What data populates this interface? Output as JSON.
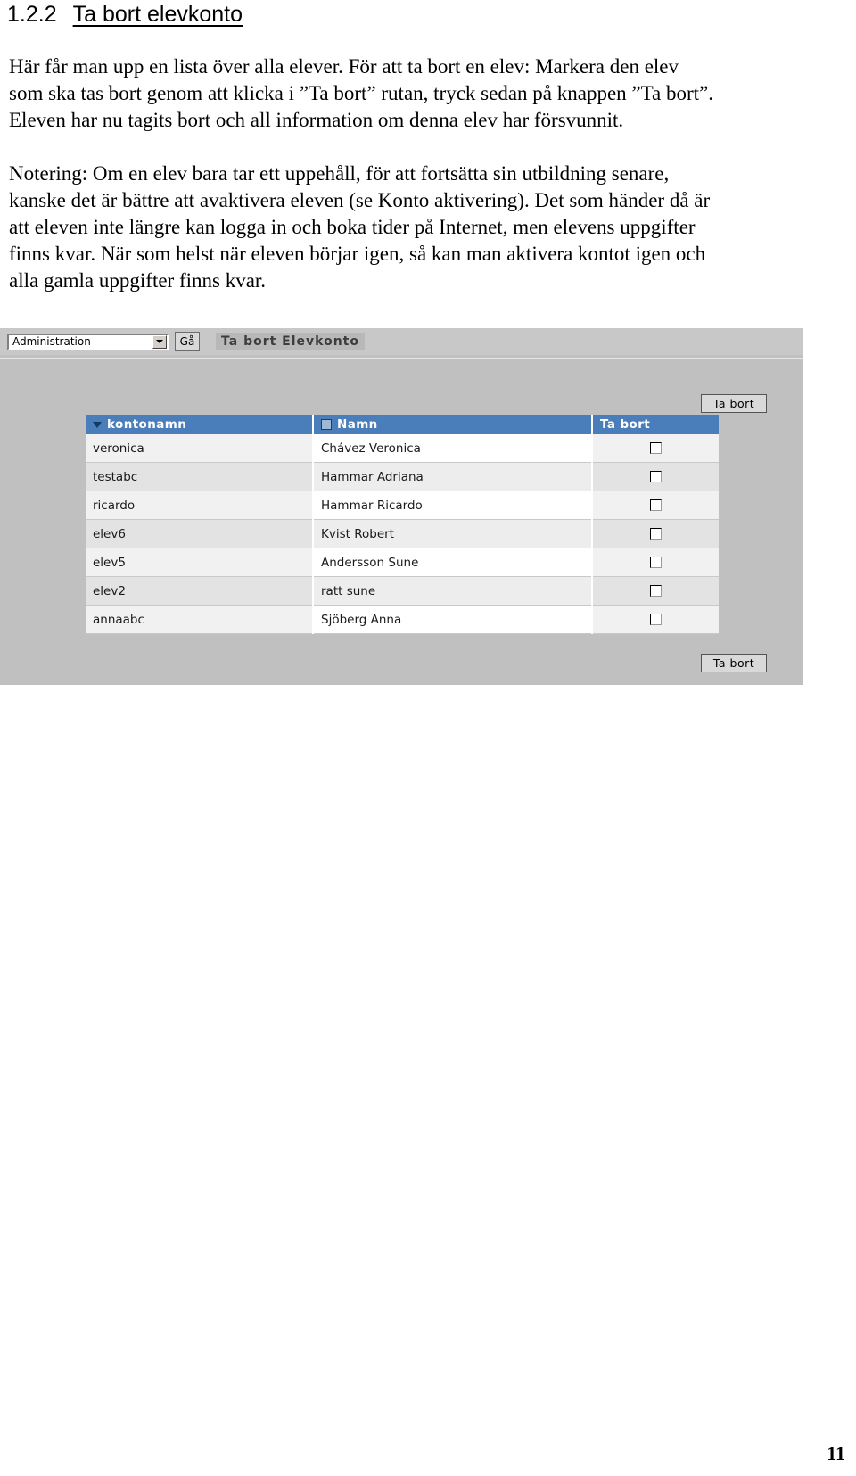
{
  "heading": {
    "number": "1.2.2",
    "title": "Ta bort elevkonto"
  },
  "paragraphs": [
    {
      "id": "para-1",
      "lines": [
        "Här får man upp en lista över alla elever. För att ta bort en elev: Markera den elev",
        "som ska tas bort genom att klicka i ”Ta bort” rutan, tryck sedan på knappen ”Ta bort”.",
        "Eleven har nu tagits bort och all information om denna elev har försvunnit."
      ]
    },
    {
      "id": "para-2",
      "lines": [
        "Notering: Om en elev bara tar ett uppehåll, för att fortsätta sin utbildning senare,",
        "kanske det är bättre att avaktivera eleven (se Konto aktivering). Det som händer då är",
        "att eleven inte längre kan logga in och boka tider på Internet, men elevens uppgifter",
        "finns kvar. När som helst när eleven börjar igen, så kan man aktivera kontot igen och",
        "alla gamla uppgifter finns kvar."
      ]
    }
  ],
  "screenshot": {
    "toolbar": {
      "module_select": {
        "value": "Administration",
        "arrow_icon": "chevron-down-icon"
      },
      "go_button": "Gå",
      "page_title": "Ta bort Elevkonto"
    },
    "delete_button_top": "Ta bort",
    "delete_button_bottom": "Ta bort",
    "table": {
      "columns": [
        {
          "label": "kontonamn",
          "icon": "sort-descending-icon"
        },
        {
          "label": "Namn",
          "icon": "column-box-icon"
        },
        {
          "label": "Ta bort",
          "icon": ""
        }
      ],
      "rows": [
        {
          "kontonamn": "veronica",
          "namn": "Chávez Veronica",
          "ta_bort": false
        },
        {
          "kontonamn": "testabc",
          "namn": "Hammar Adriana",
          "ta_bort": false
        },
        {
          "kontonamn": "ricardo",
          "namn": "Hammar Ricardo",
          "ta_bort": false
        },
        {
          "kontonamn": "elev6",
          "namn": "Kvist Robert",
          "ta_bort": false
        },
        {
          "kontonamn": "elev5",
          "namn": "Andersson Sune",
          "ta_bort": false
        },
        {
          "kontonamn": "elev2",
          "namn": "ratt sune",
          "ta_bort": false
        },
        {
          "kontonamn": "annaabc",
          "namn": "Sjöberg Anna",
          "ta_bort": false
        }
      ]
    },
    "colors": {
      "header_blue": "#4a7ebb",
      "chrome_gray": "#c0c0c0",
      "row_stripe": "#e3e3e3"
    }
  },
  "page_number": "11"
}
